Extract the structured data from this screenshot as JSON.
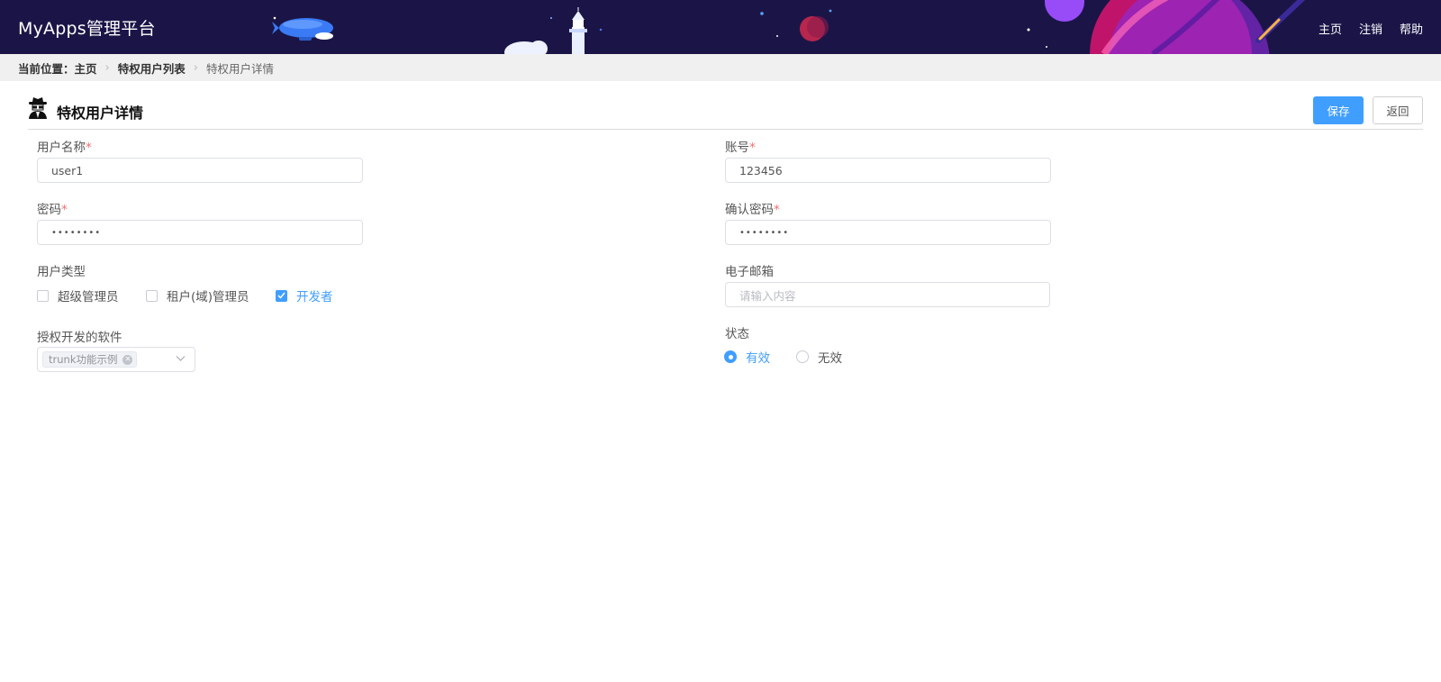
{
  "header": {
    "app_title": "MyApps管理平台",
    "nav": [
      "主页",
      "注销",
      "帮助"
    ],
    "background_color": "#1b1547"
  },
  "breadcrumb": {
    "prefix": "当前位置：",
    "items": [
      "主页",
      "特权用户列表",
      "特权用户详情"
    ]
  },
  "page": {
    "title": "特权用户详情",
    "icon": "spy-icon",
    "save_label": "保存",
    "back_label": "返回"
  },
  "form": {
    "username": {
      "label": "用户名称",
      "required_mark": "*",
      "value": "user1"
    },
    "account": {
      "label": "账号",
      "required_mark": "*",
      "value": "123456"
    },
    "password": {
      "label": "密码",
      "required_mark": "*",
      "value": "••••••••"
    },
    "confirm_password": {
      "label": "确认密码",
      "required_mark": "*",
      "value": "••••••••"
    },
    "user_type": {
      "label": "用户类型",
      "options": [
        {
          "label": "超级管理员",
          "checked": false
        },
        {
          "label": "租户(域)管理员",
          "checked": false
        },
        {
          "label": "开发者",
          "checked": true
        }
      ]
    },
    "email": {
      "label": "电子邮箱",
      "value": "",
      "placeholder": "请输入内容"
    },
    "software": {
      "label": "授权开发的软件",
      "tags": [
        "trunk功能示例"
      ]
    },
    "status": {
      "label": "状态",
      "options": [
        {
          "label": "有效",
          "selected": true
        },
        {
          "label": "无效",
          "selected": false
        }
      ]
    }
  },
  "colors": {
    "primary": "#409eff",
    "required": "#f56c6c",
    "header": "#1b1547"
  }
}
